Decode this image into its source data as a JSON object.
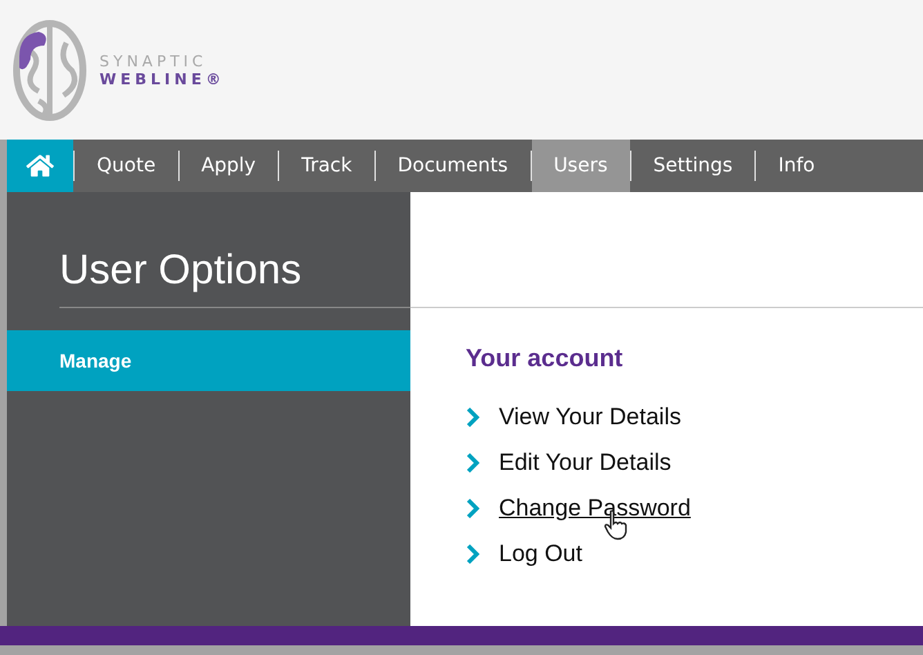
{
  "logo": {
    "line_1": "SYNAPTIC",
    "line_2": "WEBLINE®"
  },
  "nav": [
    {
      "kind": "home"
    },
    {
      "kind": "text",
      "label": "Quote",
      "selected": false
    },
    {
      "kind": "text",
      "label": "Apply",
      "selected": false
    },
    {
      "kind": "text",
      "label": "Track",
      "selected": false
    },
    {
      "kind": "text",
      "label": "Documents",
      "selected": false
    },
    {
      "kind": "text",
      "label": "Users",
      "selected": true
    },
    {
      "kind": "text",
      "label": "Settings",
      "selected": false
    },
    {
      "kind": "text",
      "label": "Info",
      "selected": false
    }
  ],
  "sidebar": {
    "title": "User Options",
    "items": [
      {
        "label": "Manage",
        "selected": true
      }
    ]
  },
  "account": {
    "heading": "Your account",
    "links": [
      {
        "label": "View Your Details",
        "hovered": false
      },
      {
        "label": "Edit Your Details",
        "hovered": false
      },
      {
        "label": "Change Password",
        "hovered": true
      },
      {
        "label": "Log Out",
        "hovered": false
      }
    ]
  }
}
